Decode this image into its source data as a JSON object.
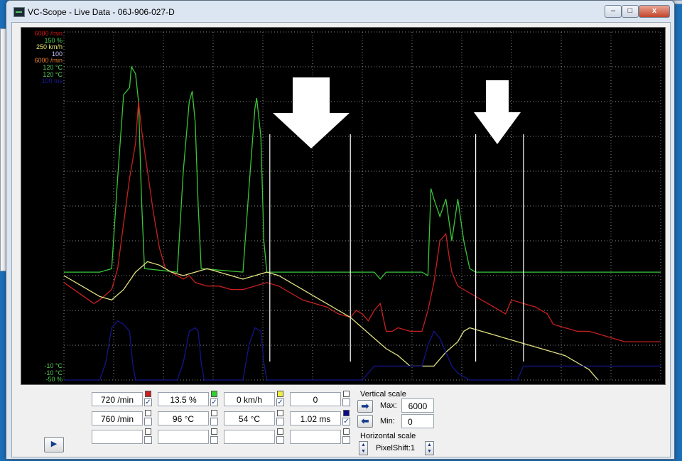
{
  "window": {
    "title": "VC-Scope  -  Live Data  -  06J-906-027-D",
    "minimize": "–",
    "maximize": "□",
    "close": "x"
  },
  "scope": {
    "top_labels": [
      {
        "text": "6000 /min",
        "color": "#d01818"
      },
      {
        "text": "150 %",
        "color": "#48d048"
      },
      {
        "text": "250 km/h",
        "color": "#e8e870"
      },
      {
        "text": "100",
        "color": "#c8c8ff"
      },
      {
        "text": "6000 /min",
        "color": "#e88030"
      },
      {
        "text": "120 °C",
        "color": "#58c858"
      },
      {
        "text": "120 °C",
        "color": "#58c858"
      },
      {
        "text": "100 ms",
        "color": "#1a1a9a"
      }
    ],
    "bottom_labels": [
      {
        "text": "-10 °C",
        "color": "#58c858"
      },
      {
        "text": "-10 °C",
        "color": "#58c858"
      },
      {
        "text": "-50 %",
        "color": "#48d048"
      }
    ]
  },
  "chart_data": {
    "type": "line",
    "xlim": [
      0,
      100
    ],
    "ylim": [
      0,
      100
    ],
    "grid": true,
    "series": [
      {
        "color": "#39c639",
        "points": [
          [
            0,
            31
          ],
          [
            6,
            31
          ],
          [
            8,
            32
          ],
          [
            9,
            58
          ],
          [
            10,
            82
          ],
          [
            11,
            84
          ],
          [
            11.3,
            90
          ],
          [
            12,
            88
          ],
          [
            12.5,
            80
          ],
          [
            13,
            52
          ],
          [
            13.5,
            32
          ],
          [
            19,
            31
          ],
          [
            20,
            60
          ],
          [
            21,
            80
          ],
          [
            21.5,
            83
          ],
          [
            22,
            74
          ],
          [
            22.5,
            50
          ],
          [
            23,
            32
          ],
          [
            30,
            31
          ],
          [
            31,
            55
          ],
          [
            32,
            78
          ],
          [
            32.3,
            81
          ],
          [
            33,
            70
          ],
          [
            33.5,
            40
          ],
          [
            34,
            31
          ],
          [
            52,
            31
          ],
          [
            53,
            29
          ],
          [
            54,
            31
          ],
          [
            60,
            31
          ],
          [
            61,
            30
          ],
          [
            61.5,
            55
          ],
          [
            62,
            52
          ],
          [
            63,
            47
          ],
          [
            64,
            52
          ],
          [
            65,
            40
          ],
          [
            66,
            52
          ],
          [
            67,
            40
          ],
          [
            68,
            32
          ],
          [
            69,
            31
          ],
          [
            100,
            31
          ]
        ]
      },
      {
        "color": "#c82020",
        "points": [
          [
            0,
            28
          ],
          [
            5,
            22
          ],
          [
            6,
            23
          ],
          [
            8,
            26
          ],
          [
            9,
            32
          ],
          [
            10,
            45
          ],
          [
            11,
            58
          ],
          [
            12,
            68
          ],
          [
            12.5,
            80
          ],
          [
            13,
            72
          ],
          [
            14,
            60
          ],
          [
            15,
            48
          ],
          [
            16,
            38
          ],
          [
            17,
            32
          ],
          [
            18,
            31
          ],
          [
            19,
            30
          ],
          [
            20,
            29
          ],
          [
            21,
            30
          ],
          [
            22,
            28
          ],
          [
            24,
            27
          ],
          [
            26,
            27
          ],
          [
            28,
            26
          ],
          [
            30,
            26
          ],
          [
            32,
            27
          ],
          [
            34,
            28
          ],
          [
            36,
            27
          ],
          [
            38,
            25
          ],
          [
            40,
            23
          ],
          [
            42,
            22
          ],
          [
            44,
            21
          ],
          [
            46,
            19
          ],
          [
            48,
            18
          ],
          [
            49,
            20
          ],
          [
            50,
            19
          ],
          [
            51,
            17
          ],
          [
            52,
            20
          ],
          [
            53,
            22
          ],
          [
            54,
            14
          ],
          [
            55,
            14
          ],
          [
            56,
            15
          ],
          [
            58,
            14
          ],
          [
            60,
            14
          ],
          [
            61,
            20
          ],
          [
            62,
            28
          ],
          [
            63,
            40
          ],
          [
            64,
            42
          ],
          [
            64.5,
            36
          ],
          [
            65,
            31
          ],
          [
            66,
            27
          ],
          [
            68,
            25
          ],
          [
            70,
            23
          ],
          [
            72,
            21
          ],
          [
            74,
            19
          ],
          [
            75,
            23
          ],
          [
            77,
            22
          ],
          [
            79,
            21
          ],
          [
            81,
            19
          ],
          [
            82,
            16
          ],
          [
            84,
            15
          ],
          [
            86,
            14
          ],
          [
            88,
            14
          ],
          [
            90,
            13
          ],
          [
            92,
            12
          ],
          [
            94,
            11
          ],
          [
            100,
            11
          ]
        ]
      },
      {
        "color": "#e0e080",
        "points": [
          [
            0,
            30
          ],
          [
            2,
            28
          ],
          [
            4,
            26
          ],
          [
            6,
            24
          ],
          [
            8,
            23
          ],
          [
            10,
            26
          ],
          [
            12,
            31
          ],
          [
            14,
            34
          ],
          [
            16,
            33
          ],
          [
            18,
            31
          ],
          [
            20,
            30
          ],
          [
            22,
            31
          ],
          [
            24,
            32
          ],
          [
            26,
            31
          ],
          [
            28,
            30
          ],
          [
            30,
            29
          ],
          [
            32,
            30
          ],
          [
            34,
            31
          ],
          [
            36,
            30
          ],
          [
            38,
            28
          ],
          [
            40,
            26
          ],
          [
            42,
            24
          ],
          [
            44,
            22
          ],
          [
            46,
            20
          ],
          [
            48,
            18
          ],
          [
            50,
            15
          ],
          [
            52,
            12
          ],
          [
            54,
            9
          ],
          [
            56,
            7
          ],
          [
            58,
            4
          ],
          [
            60,
            4
          ],
          [
            62,
            4
          ],
          [
            64,
            8
          ],
          [
            66,
            11
          ],
          [
            67,
            14
          ],
          [
            68,
            15
          ],
          [
            70,
            14
          ],
          [
            72,
            13
          ],
          [
            74,
            12
          ],
          [
            76,
            11
          ],
          [
            78,
            10
          ],
          [
            80,
            9
          ],
          [
            82,
            8
          ],
          [
            84,
            7
          ],
          [
            86,
            5
          ],
          [
            88,
            3
          ],
          [
            89,
            1
          ],
          [
            89.5,
            0
          ]
        ]
      },
      {
        "color": "#14148a",
        "points": [
          [
            0,
            0
          ],
          [
            6,
            0
          ],
          [
            7,
            5
          ],
          [
            8,
            15
          ],
          [
            9,
            17
          ],
          [
            10,
            16
          ],
          [
            11,
            14
          ],
          [
            11.5,
            5
          ],
          [
            12,
            0
          ],
          [
            19,
            0
          ],
          [
            20,
            5
          ],
          [
            21,
            14
          ],
          [
            22,
            15
          ],
          [
            22.5,
            14
          ],
          [
            23,
            5
          ],
          [
            23.5,
            0
          ],
          [
            30,
            0
          ],
          [
            31,
            10
          ],
          [
            32,
            15
          ],
          [
            33,
            14
          ],
          [
            33.5,
            5
          ],
          [
            34,
            0
          ],
          [
            50,
            0
          ],
          [
            52,
            4
          ],
          [
            54,
            4
          ],
          [
            60,
            4
          ],
          [
            61,
            10
          ],
          [
            62,
            14
          ],
          [
            63,
            12
          ],
          [
            64,
            8
          ],
          [
            65,
            4
          ],
          [
            66,
            2
          ],
          [
            68,
            0
          ],
          [
            76,
            0
          ],
          [
            77,
            4
          ],
          [
            100,
            4
          ]
        ]
      }
    ]
  },
  "channels": [
    {
      "value": "720 /min",
      "swatch": "#cc2020",
      "checked": true
    },
    {
      "value": "13.5 %",
      "swatch": "#30d030",
      "checked": true
    },
    {
      "value": "0 km/h",
      "swatch": "#f0f040",
      "checked": true
    },
    {
      "value": "0",
      "swatch": "#ffffff",
      "checked": false
    },
    {
      "value": "760 /min",
      "swatch": "#ffffff",
      "checked": false
    },
    {
      "value": "96 °C",
      "swatch": "#ffffff",
      "checked": false
    },
    {
      "value": "54 °C",
      "swatch": "#ffffff",
      "checked": false
    },
    {
      "value": "1.02 ms",
      "swatch": "#0a0a8a",
      "checked": true
    },
    {
      "value": "",
      "swatch": "#ffffff",
      "checked": false
    },
    {
      "value": "",
      "swatch": "#ffffff",
      "checked": false
    },
    {
      "value": "",
      "swatch": "#ffffff",
      "checked": false
    },
    {
      "value": "",
      "swatch": "#ffffff",
      "checked": false
    }
  ],
  "vertical_scale": {
    "label": "Vertical scale",
    "max_label": "Max:",
    "max_value": "6000",
    "min_label": "Min:",
    "min_value": "0"
  },
  "horizontal_scale": {
    "label": "Horizontal scale",
    "value": "PixelShift:1"
  }
}
